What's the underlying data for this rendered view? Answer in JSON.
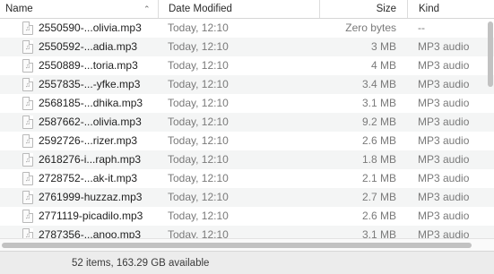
{
  "columns": {
    "name": "Name",
    "date_modified": "Date Modified",
    "size": "Size",
    "kind": "Kind"
  },
  "file_icon": "music-file-icon",
  "files": [
    {
      "name": "2550590-...olivia.mp3",
      "date": "Today, 12:10",
      "size": "Zero bytes",
      "kind": "--"
    },
    {
      "name": "2550592-...adia.mp3",
      "date": "Today, 12:10",
      "size": "3 MB",
      "kind": "MP3 audio"
    },
    {
      "name": "2550889-...toria.mp3",
      "date": "Today, 12:10",
      "size": "4 MB",
      "kind": "MP3 audio"
    },
    {
      "name": "2557835-...-yfke.mp3",
      "date": "Today, 12:10",
      "size": "3.4 MB",
      "kind": "MP3 audio"
    },
    {
      "name": "2568185-...dhika.mp3",
      "date": "Today, 12:10",
      "size": "3.1 MB",
      "kind": "MP3 audio"
    },
    {
      "name": "2587662-...olivia.mp3",
      "date": "Today, 12:10",
      "size": "9.2 MB",
      "kind": "MP3 audio"
    },
    {
      "name": "2592726-...rizer.mp3",
      "date": "Today, 12:10",
      "size": "2.6 MB",
      "kind": "MP3 audio"
    },
    {
      "name": "2618276-i...raph.mp3",
      "date": "Today, 12:10",
      "size": "1.8 MB",
      "kind": "MP3 audio"
    },
    {
      "name": "2728752-...ak-it.mp3",
      "date": "Today, 12:10",
      "size": "2.1 MB",
      "kind": "MP3 audio"
    },
    {
      "name": "2761999-huzzaz.mp3",
      "date": "Today, 12:10",
      "size": "2.7 MB",
      "kind": "MP3 audio"
    },
    {
      "name": "2771119-picadilo.mp3",
      "date": "Today, 12:10",
      "size": "2.6 MB",
      "kind": "MP3 audio"
    },
    {
      "name": "2787356-...anoo.mp3",
      "date": "Today, 12:10",
      "size": "3.1 MB",
      "kind": "MP3 audio"
    }
  ],
  "status": "52 items, 163.29 GB available"
}
